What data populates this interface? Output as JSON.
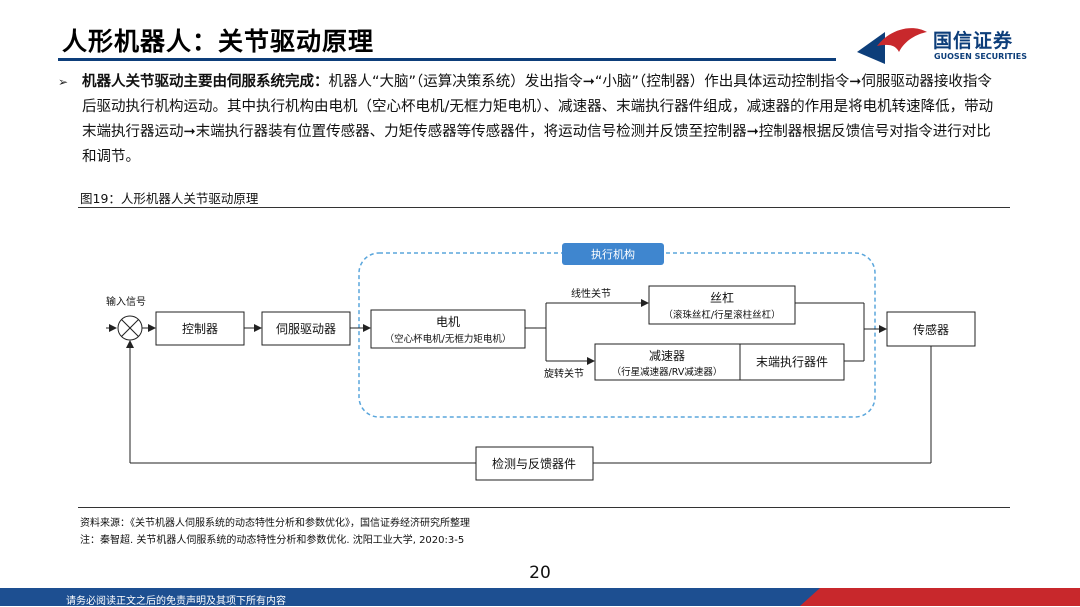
{
  "slide": {
    "title": "人形机器人：关节驱动原理",
    "page_number": "20",
    "footer_disclaimer": "请务必阅读正文之后的免责声明及其项下所有内容"
  },
  "logo": {
    "name_cn": "国信证券",
    "name_en": "GUOSEN SECURITIES"
  },
  "body": {
    "bullet_symbol": "➢",
    "bold_lead": "机器人关节驱动主要由伺服系统完成：",
    "text": "机器人“大脑”（运算决策系统）发出指令➞“小脑”（控制器）作出具体运动控制指令➞伺服驱动器接收指令后驱动执行机构运动。其中执行机构由电机（空心杯电机/无框力矩电机）、减速器、末端执行器件组成，减速器的作用是将电机转速降低，带动末端执行器运动➞末端执行器装有位置传感器、力矩传感器等传感器件，将运动信号检测并反馈至控制器➞控制器根据反馈信号对指令进行对比和调节。"
  },
  "figure": {
    "caption": "图19：人形机器人关节驱动原理",
    "source": "资料来源：《关节机器人伺服系统的动态特性分析和参数优化》，国信证券经济研究所整理",
    "note": "注：秦智超. 关节机器人伺服系统的动态特性分析和参数优化. 沈阳工业大学, 2020:3-5"
  },
  "diagram": {
    "input_label": "输入信号",
    "controller": "控制器",
    "servo_driver": "伺服驱动器",
    "actuator_group": "执行机构",
    "motor": "电机",
    "motor_sub": "（空心杯电机/无框力矩电机）",
    "linear_joint": "线性关节",
    "rotary_joint": "旋转关节",
    "lead_screw": "丝杠",
    "lead_screw_sub": "（滚珠丝杠/行星滚柱丝杠）",
    "reducer": "减速器",
    "reducer_sub": "（行星减速器/RV减速器）",
    "end_effector": "末端执行器件",
    "sensor": "传感器",
    "feedback": "检测与反馈器件"
  },
  "colors": {
    "brand_navy": "#0d3e7a",
    "brand_red": "#c8282c",
    "dashed_border": "#5aa6dc",
    "group_label_bg": "#3f86cf",
    "footer_blue": "#1d4f91"
  }
}
